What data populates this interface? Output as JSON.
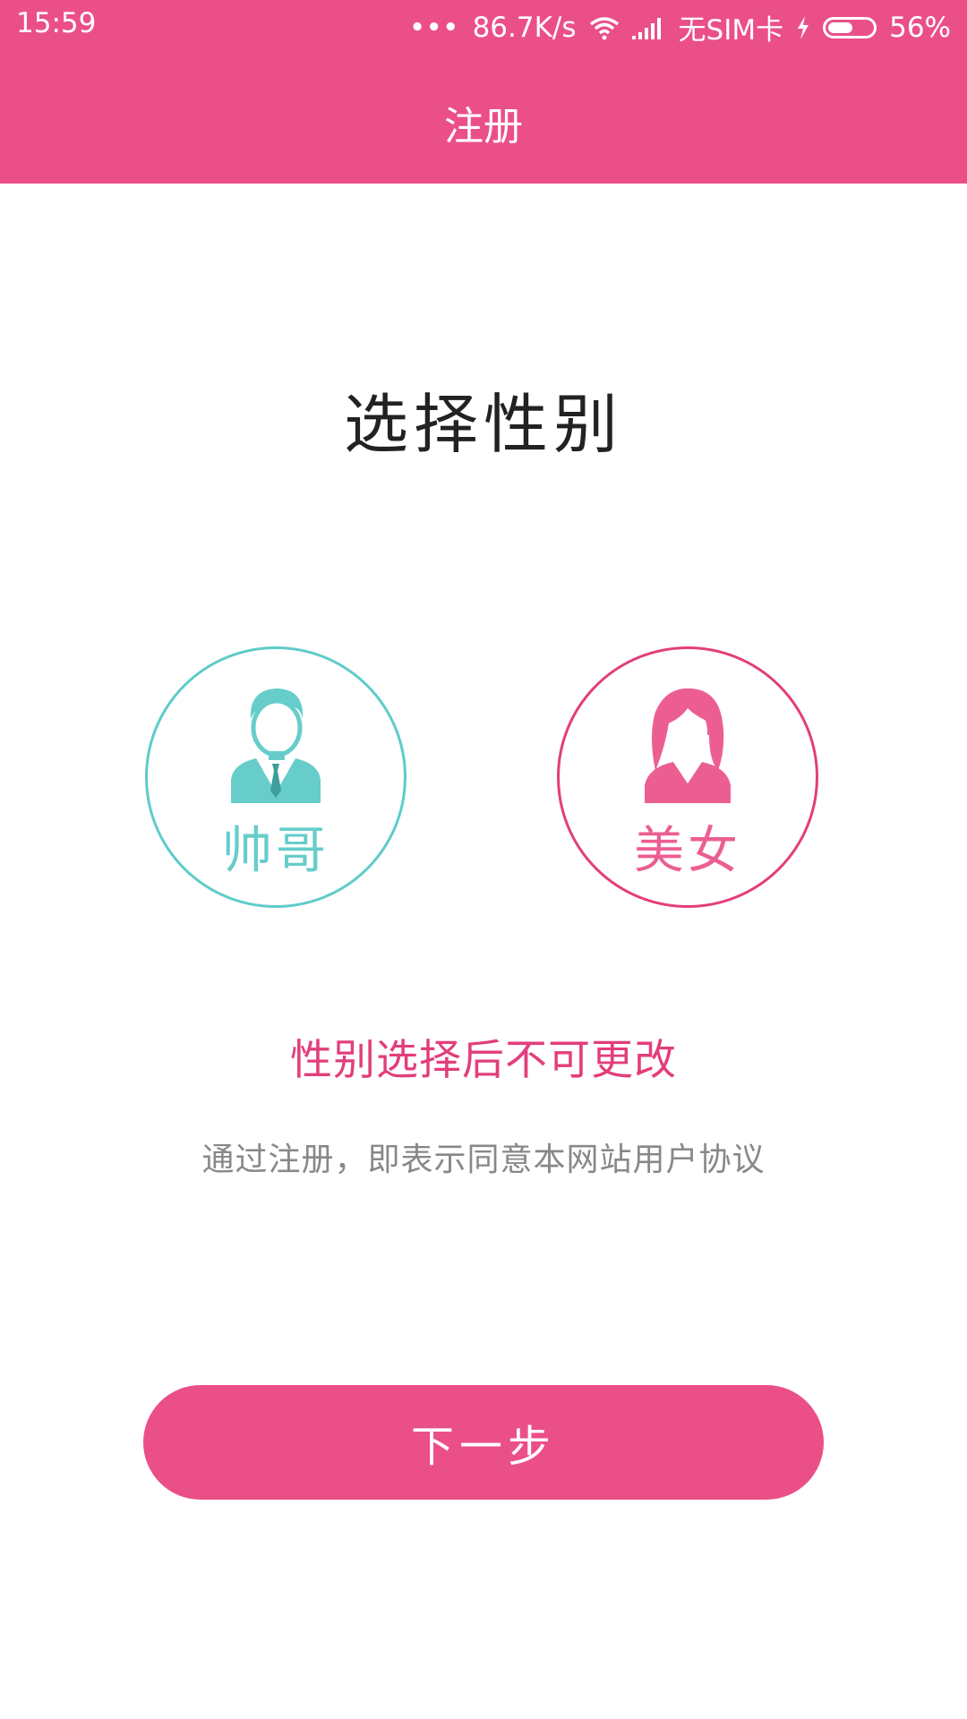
{
  "status_bar": {
    "time": "15:59",
    "network_speed": "86.7K/s",
    "sim_status": "无SIM卡",
    "battery_percent": "56%",
    "battery_level": 0.56
  },
  "header": {
    "title": "注册"
  },
  "main": {
    "title": "选择性别",
    "male": {
      "label": "帅哥",
      "color": "#5ECCC9"
    },
    "female": {
      "label": "美女",
      "color": "#E23E7B"
    },
    "warning_text": "性别选择后不可更改",
    "agreement_text": "通过注册，即表示同意本网站用户协议"
  },
  "next_button": {
    "label": "下一步"
  },
  "colors": {
    "brand": "#EB4F88",
    "male_accent": "#5ECCC9",
    "female_accent": "#E23E7B"
  }
}
